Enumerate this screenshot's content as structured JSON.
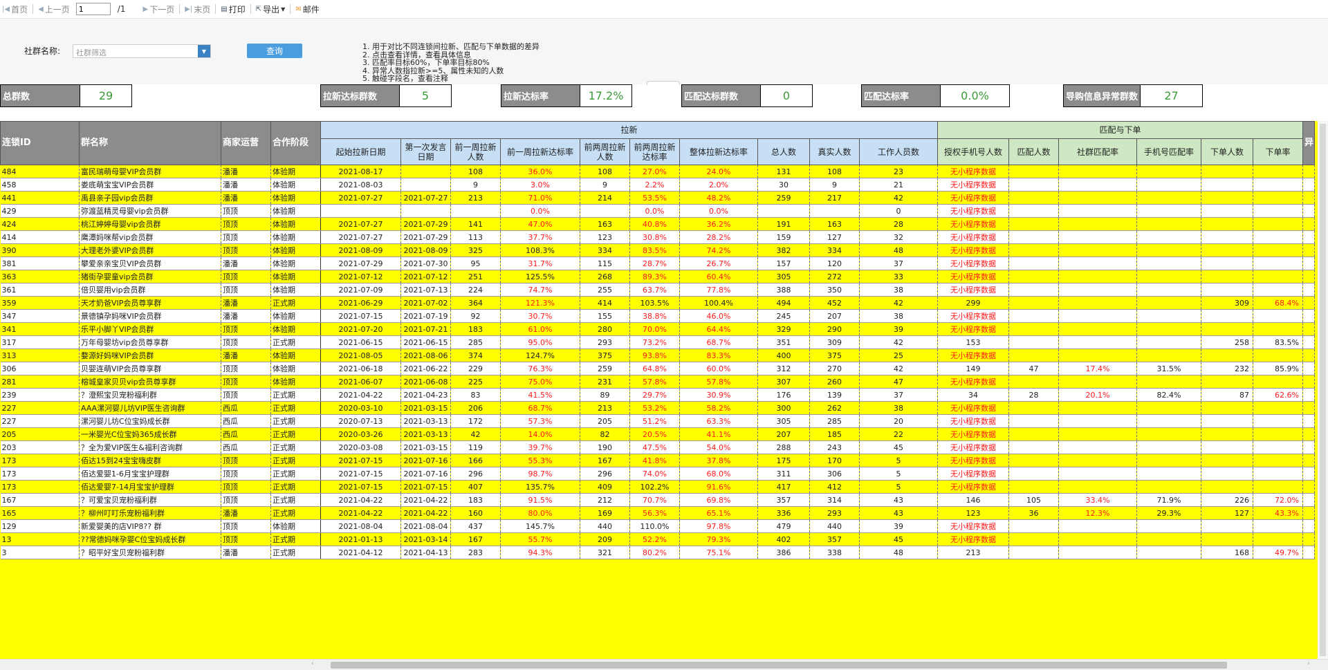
{
  "toolbar": {
    "first": "首页",
    "prev": "上一页",
    "page": "1",
    "total": "/1",
    "next": "下一页",
    "last": "末页",
    "print": "打印",
    "export": "导出",
    "mail": "邮件"
  },
  "filter": {
    "label": "社群名称:",
    "placeholder": "社群筛选",
    "query": "查询"
  },
  "notes": [
    "1. 用于对比不同连锁间拉新、匹配与下单数据的差异",
    "2. 点击查看详情，查看具体信息",
    "3. 匹配率目标60%，下单率目标80%",
    "4. 异常人数指拉新>=5、属性未知的人数",
    "5. 触碰字段名，查看注释"
  ],
  "kpis": [
    {
      "label": "总群数",
      "value": "29"
    },
    {
      "label": "拉新达标群数",
      "value": "5"
    },
    {
      "label": "拉新达标率",
      "value": "17.2%"
    },
    {
      "label": "匹配达标群数",
      "value": "0"
    },
    {
      "label": "匹配达标率",
      "value": "0.0%"
    },
    {
      "label": "导购信息异常群数",
      "value": "27"
    }
  ],
  "headers": {
    "id": "连锁ID",
    "name": "群名称",
    "merchant": "商家运营",
    "stage": "合作阶段",
    "group_lx": "拉新",
    "group_pp": "匹配与下单",
    "cut": "异",
    "cols": [
      "起始拉新日期",
      "第一次发言日期",
      "前一周拉新人数",
      "前一周拉新达标率",
      "前两周拉新人数",
      "前两周拉新达标率",
      "整体拉新达标率",
      "总人数",
      "真实人数",
      "工作人员数",
      "授权手机号人数",
      "匹配人数",
      "社群匹配率",
      "手机号匹配率",
      "下单人数",
      "下单率"
    ]
  },
  "rows": [
    [
      "484",
      "富民瑞萌母婴VIP会员群",
      "潘潘",
      "体验期",
      "2021-08-17",
      "",
      "108",
      "36.0%",
      "108",
      "27.0%",
      "24.0%",
      "131",
      "108",
      "23",
      "无小程序数据",
      "",
      "",
      "",
      "",
      ""
    ],
    [
      "458",
      "娄底萌宝宝VIP会员群",
      "潘潘",
      "体验期",
      "2021-08-03",
      "",
      "9",
      "3.0%",
      "9",
      "2.2%",
      "2.0%",
      "30",
      "9",
      "21",
      "无小程序数据",
      "",
      "",
      "",
      "",
      ""
    ],
    [
      "441",
      "禹县亲子园vip会员群",
      "潘潘",
      "体验期",
      "2021-07-27",
      "2021-07-27",
      "213",
      "71.0%",
      "214",
      "53.5%",
      "48.2%",
      "259",
      "217",
      "42",
      "无小程序数据",
      "",
      "",
      "",
      "",
      ""
    ],
    [
      "429",
      "弥渡蓝精灵母婴vip会员群",
      "顶顶",
      "体验期",
      "",
      "",
      "",
      "0.0%",
      "",
      "0.0%",
      "0.0%",
      "",
      "",
      "0",
      "无小程序数据",
      "",
      "",
      "",
      "",
      ""
    ],
    [
      "424",
      "桃江婷婷母婴vip会员群",
      "顶顶",
      "体验期",
      "2021-07-27",
      "2021-07-29",
      "141",
      "47.0%",
      "163",
      "40.8%",
      "36.2%",
      "191",
      "163",
      "28",
      "无小程序数据",
      "",
      "",
      "",
      "",
      ""
    ],
    [
      "414",
      "鹰潭妈咪帮vip会员群",
      "顶顶",
      "体验期",
      "2021-07-27",
      "2021-07-29",
      "113",
      "37.7%",
      "123",
      "30.8%",
      "28.2%",
      "159",
      "127",
      "32",
      "无小程序数据",
      "",
      "",
      "",
      "",
      ""
    ],
    [
      "390",
      "大理老外婆VIP会员群",
      "顶顶",
      "体验期",
      "2021-08-09",
      "2021-08-09",
      "325",
      "108.3%",
      "334",
      "83.5%",
      "74.2%",
      "382",
      "334",
      "48",
      "无小程序数据",
      "",
      "",
      "",
      "",
      ""
    ],
    [
      "381",
      "攀爱亲亲宝贝VIP会员群",
      "潘潘",
      "体验期",
      "2021-07-29",
      "2021-07-30",
      "95",
      "31.7%",
      "115",
      "28.7%",
      "26.7%",
      "157",
      "120",
      "37",
      "无小程序数据",
      "",
      "",
      "",
      "",
      ""
    ],
    [
      "363",
      "猪街孕婴童vip会员群",
      "顶顶",
      "体验期",
      "2021-07-12",
      "2021-07-12",
      "251",
      "125.5%",
      "268",
      "89.3%",
      "60.4%",
      "305",
      "272",
      "33",
      "无小程序数据",
      "",
      "",
      "",
      "",
      ""
    ],
    [
      "361",
      "倍贝婴用vip会员群",
      "顶顶",
      "体验期",
      "2021-07-09",
      "2021-07-13",
      "224",
      "74.7%",
      "255",
      "63.7%",
      "77.8%",
      "388",
      "350",
      "38",
      "无小程序数据",
      "",
      "",
      "",
      "",
      ""
    ],
    [
      "359",
      "天才奶爸VIP会员尊享群",
      "潘潘",
      "正式期",
      "2021-06-29",
      "2021-07-02",
      "364",
      "121.3%",
      "414",
      "103.5%",
      "100.4%",
      "494",
      "452",
      "42",
      "299",
      "",
      "",
      "",
      "309",
      "68.4%"
    ],
    [
      "347",
      "景德镇孕妈咪VIP会员群",
      "潘潘",
      "体验期",
      "2021-07-15",
      "2021-07-19",
      "92",
      "30.7%",
      "155",
      "38.8%",
      "46.0%",
      "245",
      "207",
      "38",
      "无小程序数据",
      "",
      "",
      "",
      "",
      ""
    ],
    [
      "341",
      "乐平小脚丫VIP会员群",
      "顶顶",
      "体验期",
      "2021-07-20",
      "2021-07-21",
      "183",
      "61.0%",
      "280",
      "70.0%",
      "64.4%",
      "329",
      "290",
      "39",
      "无小程序数据",
      "",
      "",
      "",
      "",
      ""
    ],
    [
      "317",
      "万年母婴坊vip会员尊享群",
      "顶顶",
      "正式期",
      "2021-06-15",
      "2021-06-15",
      "285",
      "95.0%",
      "293",
      "73.2%",
      "68.7%",
      "351",
      "309",
      "42",
      "153",
      "",
      "",
      "",
      "258",
      "83.5%"
    ],
    [
      "313",
      "婺源好妈咪VIP会员群",
      "潘潘",
      "体验期",
      "2021-08-05",
      "2021-08-06",
      "374",
      "124.7%",
      "375",
      "93.8%",
      "83.3%",
      "400",
      "375",
      "25",
      "无小程序数据",
      "",
      "",
      "",
      "",
      ""
    ],
    [
      "306",
      "贝婴连萌VIP会员尊享群",
      "顶顶",
      "体验期",
      "2021-06-18",
      "2021-06-22",
      "229",
      "76.3%",
      "259",
      "64.8%",
      "60.0%",
      "312",
      "270",
      "42",
      "149",
      "47",
      "17.4%",
      "31.5%",
      "232",
      "85.9%"
    ],
    [
      "281",
      "榕城皇家贝贝vip会员尊享群",
      "顶顶",
      "体验期",
      "2021-06-07",
      "2021-06-08",
      "225",
      "75.0%",
      "231",
      "57.8%",
      "57.8%",
      "307",
      "260",
      "47",
      "无小程序数据",
      "",
      "",
      "",
      "",
      ""
    ],
    [
      "239",
      "？澄熙宝贝宠粉福利群",
      "顶顶",
      "正式期",
      "2021-04-22",
      "2021-04-23",
      "83",
      "41.5%",
      "89",
      "29.7%",
      "30.9%",
      "176",
      "139",
      "37",
      "34",
      "28",
      "20.1%",
      "82.4%",
      "87",
      "62.6%"
    ],
    [
      "227",
      "AAA漯河婴儿坊VIP医生咨询群",
      "西瓜",
      "正式期",
      "2020-03-10",
      "2021-03-15",
      "206",
      "68.7%",
      "213",
      "53.2%",
      "58.2%",
      "300",
      "262",
      "38",
      "无小程序数据",
      "",
      "",
      "",
      "",
      ""
    ],
    [
      "227",
      "漯河婴儿坊C位宝妈成长群",
      "西瓜",
      "正式期",
      "2020-07-13",
      "2021-03-13",
      "172",
      "57.3%",
      "205",
      "51.2%",
      "63.3%",
      "305",
      "285",
      "20",
      "无小程序数据",
      "",
      "",
      "",
      "",
      ""
    ],
    [
      "205",
      "一米婴光C位宝妈365成长群",
      "西瓜",
      "正式期",
      "2020-03-26",
      "2021-03-13",
      "42",
      "14.0%",
      "82",
      "20.5%",
      "41.1%",
      "207",
      "185",
      "22",
      "无小程序数据",
      "",
      "",
      "",
      "",
      ""
    ],
    [
      "203",
      "？全为爱VIP医生&福利咨询群",
      "西瓜",
      "正式期",
      "2020-03-08",
      "2021-03-15",
      "119",
      "39.7%",
      "190",
      "47.5%",
      "54.0%",
      "288",
      "243",
      "45",
      "无小程序数据",
      "",
      "",
      "",
      "",
      ""
    ],
    [
      "173",
      "佰达15到24宝宝嗨皮群",
      "顶顶",
      "正式期",
      "2021-07-15",
      "2021-07-16",
      "166",
      "55.3%",
      "167",
      "41.8%",
      "37.8%",
      "175",
      "170",
      "5",
      "无小程序数据",
      "",
      "",
      "",
      "",
      ""
    ],
    [
      "173",
      "佰达爱婴1-6月宝宝护理群",
      "顶顶",
      "正式期",
      "2021-07-15",
      "2021-07-16",
      "296",
      "98.7%",
      "296",
      "74.0%",
      "68.0%",
      "311",
      "306",
      "5",
      "无小程序数据",
      "",
      "",
      "",
      "",
      ""
    ],
    [
      "173",
      "佰达爱婴7-14月宝宝护理群",
      "顶顶",
      "正式期",
      "2021-07-15",
      "2021-07-15",
      "407",
      "135.7%",
      "409",
      "102.2%",
      "91.6%",
      "417",
      "412",
      "5",
      "无小程序数据",
      "",
      "",
      "",
      "",
      ""
    ],
    [
      "167",
      "？可爱宝贝宠粉福利群",
      "顶顶",
      "正式期",
      "2021-04-22",
      "2021-04-22",
      "183",
      "91.5%",
      "212",
      "70.7%",
      "69.8%",
      "357",
      "314",
      "43",
      "146",
      "105",
      "33.4%",
      "71.9%",
      "226",
      "72.0%"
    ],
    [
      "165",
      "？柳州叮叮乐宠粉福利群",
      "潘潘",
      "正式期",
      "2021-04-22",
      "2021-04-22",
      "160",
      "80.0%",
      "169",
      "56.3%",
      "65.1%",
      "336",
      "293",
      "43",
      "123",
      "36",
      "12.3%",
      "29.3%",
      "127",
      "43.3%"
    ],
    [
      "129",
      "新爱婴美的店VIP8?? 群",
      "顶顶",
      "体验期",
      "2021-08-04",
      "2021-08-04",
      "437",
      "145.7%",
      "440",
      "110.0%",
      "97.8%",
      "479",
      "440",
      "39",
      "无小程序数据",
      "",
      "",
      "",
      "",
      ""
    ],
    [
      "13",
      "??常德妈咪孕婴C位宝妈成长群",
      "顶顶",
      "正式期",
      "2021-01-13",
      "2021-03-14",
      "167",
      "55.7%",
      "209",
      "52.2%",
      "79.3%",
      "402",
      "357",
      "45",
      "无小程序数据",
      "",
      "",
      "",
      "",
      ""
    ],
    [
      "3",
      "？昭平好宝贝宠粉福利群",
      "潘潘",
      "正式期",
      "2021-04-12",
      "2021-04-13",
      "283",
      "94.3%",
      "321",
      "80.2%",
      "75.1%",
      "386",
      "338",
      "48",
      "213",
      "",
      "",
      "",
      "168",
      "49.7%"
    ]
  ],
  "colors": {
    "kpi_value": "#3a9a36",
    "header_dark": "#8c8c8c",
    "header_blue": "#c7dff5",
    "header_green": "#cfe7c2",
    "warn_red": "#ff1a1a",
    "row_yellow": "#ffff00"
  }
}
